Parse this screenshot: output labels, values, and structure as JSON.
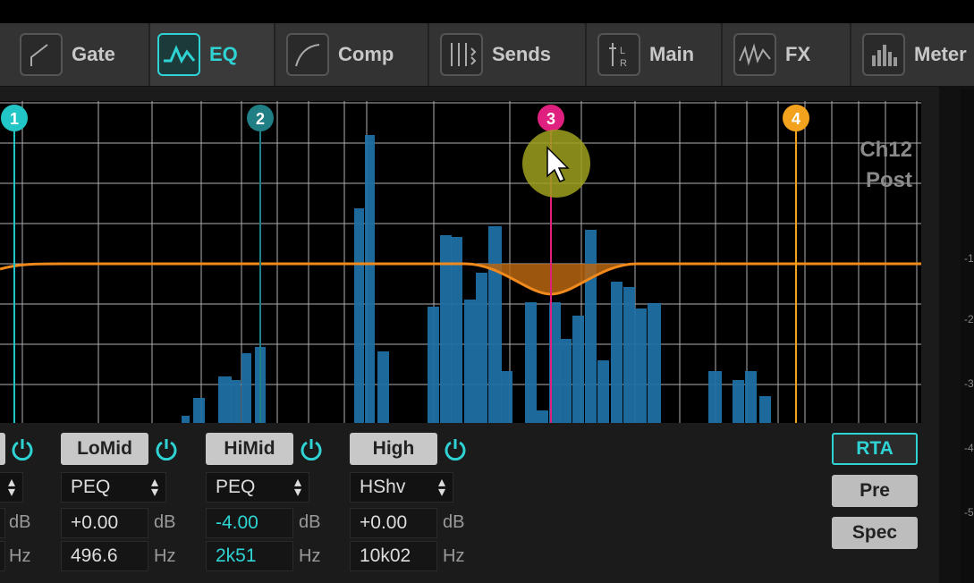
{
  "tabs": [
    {
      "label": "Gate",
      "icon": "gate-icon",
      "active": false
    },
    {
      "label": "EQ",
      "icon": "eq-icon",
      "active": true
    },
    {
      "label": "Comp",
      "icon": "comp-icon",
      "active": false
    },
    {
      "label": "Sends",
      "icon": "sends-icon",
      "active": false
    },
    {
      "label": "Main",
      "icon": "main-icon",
      "active": false
    },
    {
      "label": "FX",
      "icon": "fx-icon",
      "active": false
    },
    {
      "label": "Meter",
      "icon": "meter-icon",
      "active": false
    }
  ],
  "graph": {
    "channel_label": "Ch12",
    "tap_label": "Post",
    "markers": [
      {
        "label": "1",
        "color": "#22c6c6"
      },
      {
        "label": "2",
        "color": "#1f7f85"
      },
      {
        "label": "3",
        "color": "#e0207f"
      },
      {
        "label": "4",
        "color": "#f2a21c"
      }
    ],
    "curve_color": "#f08a1c",
    "rta_color": "#1f6fa3"
  },
  "bands": [
    {
      "name": "LoMid",
      "type": "PEQ",
      "gain": "+0.00",
      "freq": "496.6",
      "gain_active": false
    },
    {
      "name": "HiMid",
      "type": "PEQ",
      "gain": "-4.00",
      "freq": "2k51",
      "gain_active": true
    },
    {
      "name": "High",
      "type": "HShv",
      "gain": "+0.00",
      "freq": "10k02",
      "gain_active": false
    }
  ],
  "units": {
    "gain": "dB",
    "freq": "Hz"
  },
  "side_buttons": [
    {
      "label": "RTA",
      "on": true
    },
    {
      "label": "Pre",
      "on": false
    },
    {
      "label": "Spec",
      "on": false
    }
  ],
  "scale_labels": [
    "-1",
    "-2",
    "-3",
    "-4",
    "-5"
  ],
  "colors": {
    "accent": "#2fd3d3"
  }
}
